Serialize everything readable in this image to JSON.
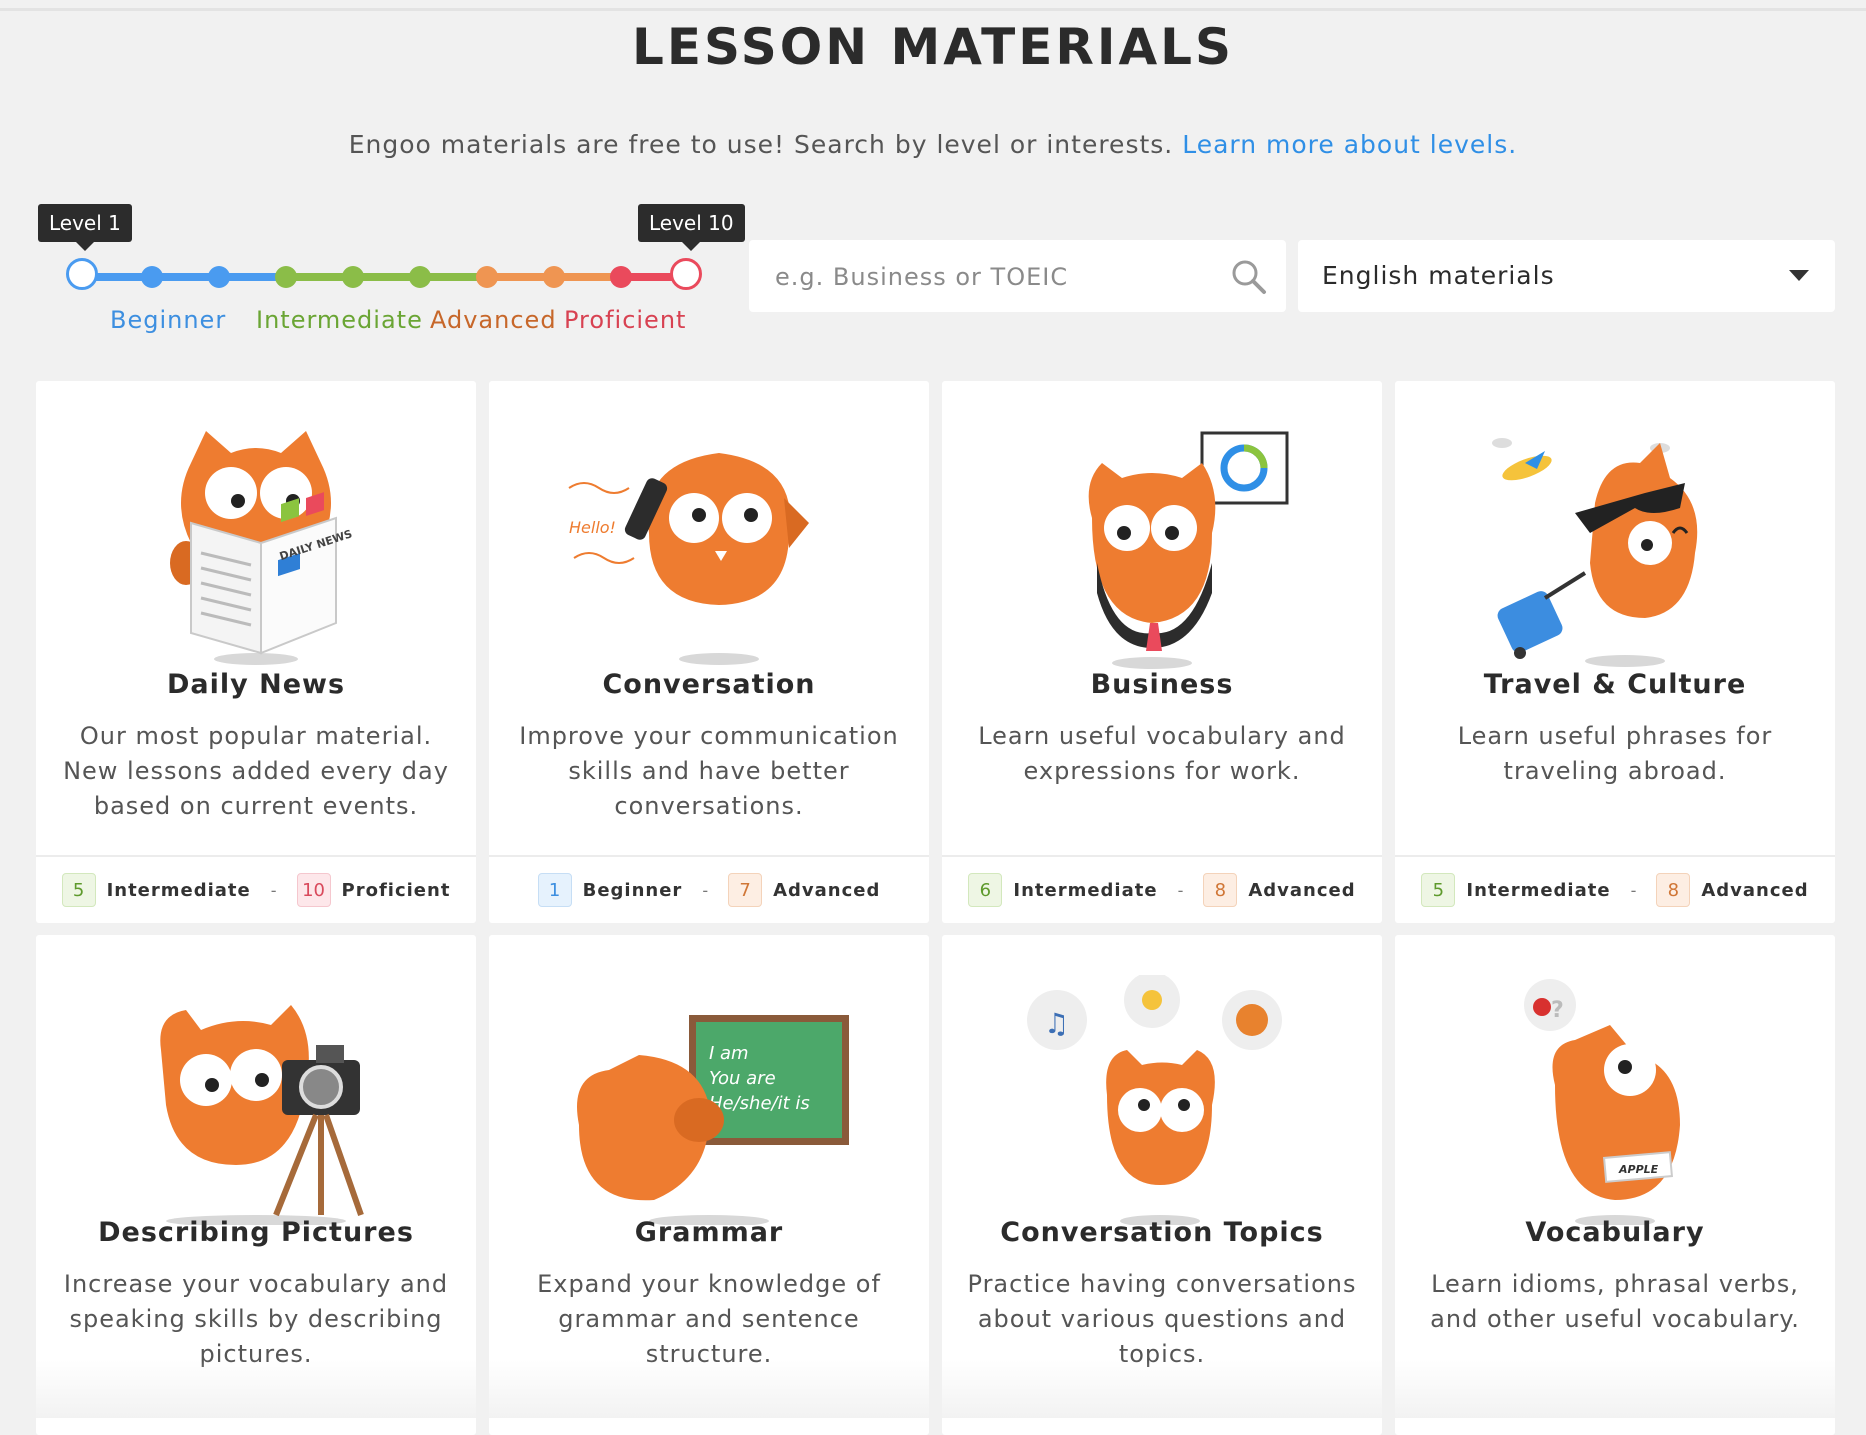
{
  "page": {
    "title": "LESSON MATERIALS",
    "subtitle": "Engoo materials are free to use! Search by level or interests.",
    "subtitle_link": "Learn more about levels."
  },
  "level_filter": {
    "start_tooltip": "Level 1",
    "end_tooltip": "Level 10",
    "range": [
      1,
      10
    ],
    "labels": [
      "Beginner",
      "Intermediate",
      "Advanced",
      "Proficient"
    ],
    "colors": {
      "beginner": "#4a9bf0",
      "intermediate": "#8bbd48",
      "advanced": "#ef9552",
      "proficient": "#ea4a5c"
    }
  },
  "search": {
    "placeholder": "e.g. Business or TOEIC",
    "value": "",
    "icon": "search-icon"
  },
  "language_select": {
    "value": "English materials",
    "icon": "chevron-down-icon"
  },
  "categories": [
    {
      "title": "Daily News",
      "description": "Our most popular material. New lessons added every day based on current events.",
      "min_level": "5",
      "min_label": "Intermediate",
      "max_level": "10",
      "max_label": "Proficient",
      "icon": "owl-reading-newspaper-icon",
      "art_text": "DAILY NEWS"
    },
    {
      "title": "Conversation",
      "description": "Improve your communication skills and have better conversations.",
      "min_level": "1",
      "min_label": "Beginner",
      "max_level": "7",
      "max_label": "Advanced",
      "icon": "owl-on-phone-icon",
      "art_text": "Hello!"
    },
    {
      "title": "Business",
      "description": "Learn useful vocabulary and expressions for work.",
      "min_level": "6",
      "min_label": "Intermediate",
      "max_level": "8",
      "max_label": "Advanced",
      "icon": "owl-presenting-chart-icon"
    },
    {
      "title": "Travel & Culture",
      "description": "Learn useful phrases for traveling abroad.",
      "min_level": "5",
      "min_label": "Intermediate",
      "max_level": "8",
      "max_label": "Advanced",
      "icon": "owl-with-suitcase-icon"
    },
    {
      "title": "Describing Pictures",
      "description": "Increase your vocabulary and speaking skills by describing pictures.",
      "icon": "owl-with-camera-icon"
    },
    {
      "title": "Grammar",
      "description": "Expand your knowledge of grammar and sentence structure.",
      "icon": "owl-at-chalkboard-icon",
      "art_text": [
        "I am",
        "You are",
        "He/she/it is"
      ]
    },
    {
      "title": "Conversation Topics",
      "description": "Practice having conversations about various questions and topics.",
      "icon": "owl-with-thought-bubbles-icon"
    },
    {
      "title": "Vocabulary",
      "description": "Learn idioms, phrasal verbs, and other useful vocabulary.",
      "icon": "owl-with-word-card-icon",
      "art_text": "APPLE"
    }
  ]
}
